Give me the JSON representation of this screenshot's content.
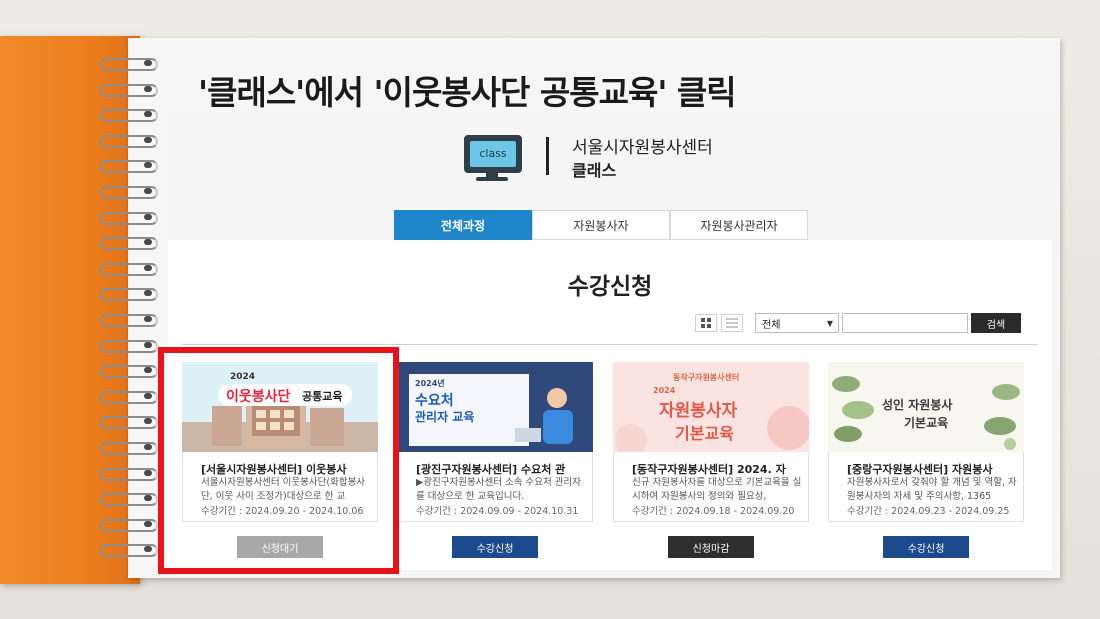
{
  "headline": "'클래스'에서 '이웃봉사단 공통교육'  클릭",
  "header": {
    "logo_text": "class",
    "org_name": "서울시자원봉사센터",
    "section_name": "클래스"
  },
  "tabs": [
    {
      "label": "전체과정",
      "active": true
    },
    {
      "label": "자원봉사자",
      "active": false
    },
    {
      "label": "자원봉사관리자",
      "active": false
    }
  ],
  "page_title": "수강신청",
  "toolbar": {
    "filter_selected": "전체",
    "search_button": "검색"
  },
  "cards": [
    {
      "thumb": {
        "line1": "2024",
        "line2": "이웃봉사단",
        "line3": "공통교육"
      },
      "title": "[서울시자원봉사센터] 이웃봉사",
      "desc": "서울시자원봉사센터 이웃봉사단(화합봉사단, 이웃 사이 조정가)대상으로 한 교",
      "date": "수강기간 : 2024.09.20 - 2024.10.06",
      "button": "신청대기",
      "button_color": "#a8a8a8"
    },
    {
      "thumb": {
        "line1": "2024년",
        "line2": "수요처",
        "line3": "관리자 교육"
      },
      "title": "[광진구자원봉사센터] 수요처 관",
      "desc": "▶광진구자원봉사센터 소속 수요처 관리자를 대상으로 한 교육입니다.",
      "date": "수강기간 : 2024.09.09 - 2024.10.31",
      "button": "수강신청",
      "button_color": "#1d4a8c"
    },
    {
      "thumb": {
        "line1": "동작구자원봉사센터",
        "line2": "2024",
        "line3": "자원봉사자",
        "line4": "기본교육"
      },
      "title": "[동작구자원봉사센터] 2024. 자",
      "desc": "신규 자원봉사자를 대상으로 기본교육을 실시하여 자원봉사의 정의와 필요성,",
      "date": "수강기간 : 2024.09.18 - 2024.09.20",
      "button": "신청마감",
      "button_color": "#2e2e2e"
    },
    {
      "thumb": {
        "line1": "성인 자원봉사",
        "line2": "기본교육"
      },
      "title": "[중랑구자원봉사센터] 자원봉사",
      "desc": "자원봉사자로서 갖춰야 할 개념 및 역할, 자원봉사자의 자세 및 주의사항, 1365",
      "date": "수강기간 : 2024.09.23 - 2024.09.25",
      "button": "수강신청",
      "button_color": "#1d4a8c"
    }
  ]
}
